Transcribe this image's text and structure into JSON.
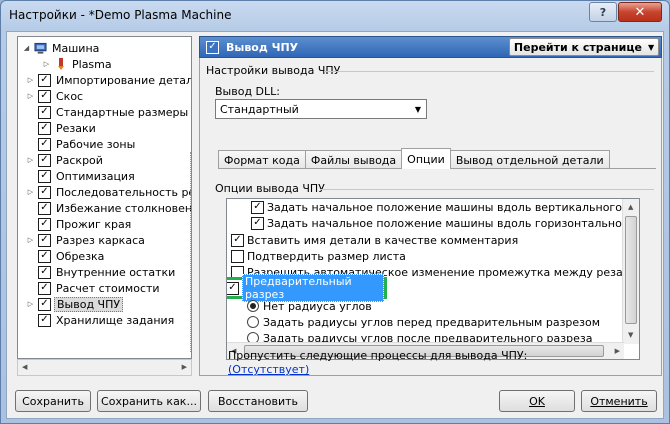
{
  "window": {
    "title": "Настройки - *Demo Plasma Machine",
    "help_label": "?",
    "close_label": "✕"
  },
  "tree": {
    "root": "Машина",
    "child": "Plasma",
    "items": [
      "Импортирование детале",
      "Скос",
      "Стандартные размеры л",
      "Резаки",
      "Рабочие зоны",
      "Раскрой",
      "Оптимизация",
      "Последовательность ре",
      "Избежание столкновени",
      "Прожиг края",
      "Разрез каркаса",
      "Обрезка",
      "Внутренние остатки",
      "Расчет стоимости",
      "Вывод ЧПУ",
      "Хранилище задания"
    ],
    "selected": "Вывод ЧПУ"
  },
  "panel": {
    "title": "Вывод ЧПУ",
    "goto_label": "Перейти к странице",
    "section_dll": "Настройки вывода ЧПУ",
    "dll_label": "Вывод DLL:",
    "dll_value": "Стандартный",
    "tabs": [
      "Формат кода",
      "Файлы вывода",
      "Опции",
      "Вывод отдельной детали"
    ],
    "active_tab": "Опции",
    "options_header": "Опции вывода ЧПУ",
    "options": [
      {
        "label": "Задать начальное положение машины вдоль вертикального края листа",
        "checked": true
      },
      {
        "label": "Задать начальное положение машины вдоль горизонтального края л...",
        "checked": true
      },
      {
        "label": "Вставить имя детали в качестве комментария",
        "checked": true
      },
      {
        "label": "Подтвердить размер листа",
        "checked": false
      },
      {
        "label": "Разрешить автоматическое изменение промежутка между резак ЧПУ",
        "checked": false
      },
      {
        "label": "Предварительный разрез",
        "checked": true
      }
    ],
    "radios": [
      {
        "label": "Нет радиуса углов",
        "selected": true
      },
      {
        "label": "Задать радиусы углов перед предварительным разрезом",
        "selected": false
      },
      {
        "label": "Задать радиусы углов после предварительного разреза",
        "selected": false
      }
    ],
    "skip_label": "Пропустить следующие процессы для вывода ЧПУ:",
    "skip_link": "(Отсутствует)"
  },
  "buttons": {
    "save": "Сохранить",
    "save_as": "Сохранить как...",
    "restore": "Восстановить",
    "ok": "OK",
    "cancel": "Отменить"
  },
  "colors": {
    "header_blue": "#2f66b5",
    "highlight_green": "#22b14c",
    "selection_blue": "#3399ff",
    "link_blue": "#0033cc"
  }
}
